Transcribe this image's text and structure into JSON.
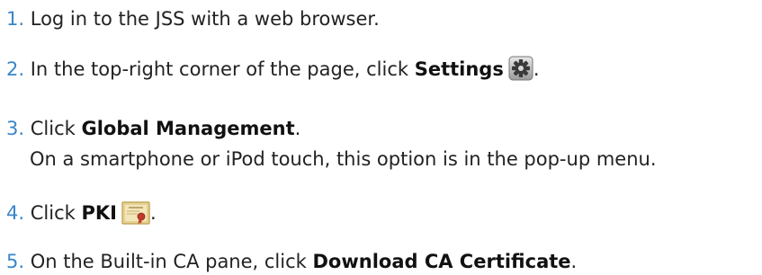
{
  "steps": [
    {
      "num": "1.",
      "text": "Log in to the JSS with a web browser."
    },
    {
      "num": "2.",
      "text_before": "In the top-right corner of the page, click ",
      "bold": "Settings",
      "icon": "gear-icon",
      "text_after": "."
    },
    {
      "num": "3.",
      "text_before": "Click ",
      "bold": "Global Management",
      "text_after": ".",
      "note": "On a smartphone or iPod touch, this option is in the pop-up menu."
    },
    {
      "num": "4.",
      "text_before": "Click ",
      "bold": "PKI",
      "icon": "certificate-icon",
      "text_after": "."
    },
    {
      "num": "5.",
      "text_before": "On the Built-in CA pane, click ",
      "bold": "Download CA Certificate",
      "text_after": "."
    }
  ],
  "colors": {
    "number": "#3a86c8",
    "text": "#222222"
  }
}
